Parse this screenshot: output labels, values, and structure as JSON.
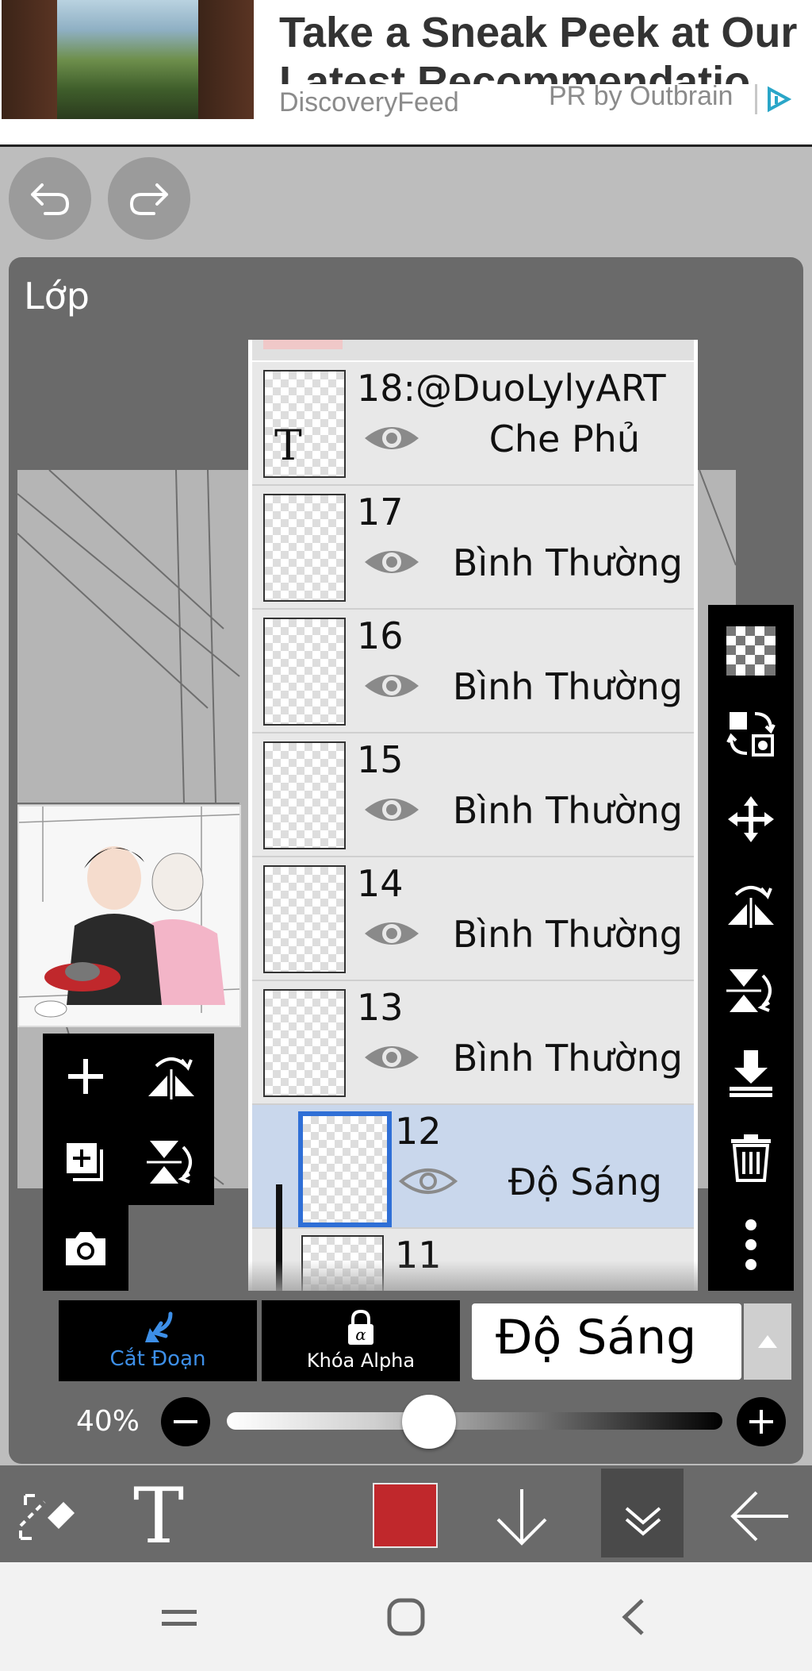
{
  "ad": {
    "title": "Take a Sneak Peek at Our Latest Recommendatio",
    "source": "DiscoveryFeed",
    "pr_label": "PR by Outbrain"
  },
  "panel": {
    "title": "Lớp"
  },
  "layers": [
    {
      "name": "18:@DuoLylyART",
      "blend": "Che Phủ",
      "thumb_icon": "T"
    },
    {
      "name": "17",
      "blend": "Bình Thường"
    },
    {
      "name": "16",
      "blend": "Bình Thường"
    },
    {
      "name": "15",
      "blend": "Bình Thường"
    },
    {
      "name": "14",
      "blend": "Bình Thường"
    },
    {
      "name": "13",
      "blend": "Bình Thường"
    },
    {
      "name": "12",
      "blend": "Độ Sáng",
      "selected": true
    },
    {
      "name": "11",
      "blend": ""
    }
  ],
  "controls": {
    "clip_label": "Cắt Đoạn",
    "alpha_label": "Khóa Alpha",
    "blend_mode": "Độ Sáng",
    "opacity_text": "40%",
    "opacity_value": 0.4
  },
  "colors": {
    "accent": "#2f6fd6",
    "current_color": "#c0282c"
  },
  "icons": {
    "side_tools": [
      "checkerboard-icon",
      "transform-icon",
      "move-icon",
      "flip-horizontal-icon",
      "flip-vertical-icon",
      "merge-down-icon",
      "trash-icon",
      "more-icon"
    ],
    "toolbar": [
      "select-tool-icon",
      "text-tool-icon",
      "color-swatch",
      "arrow-down-icon",
      "layers-collapse-icon",
      "back-arrow-icon"
    ]
  }
}
